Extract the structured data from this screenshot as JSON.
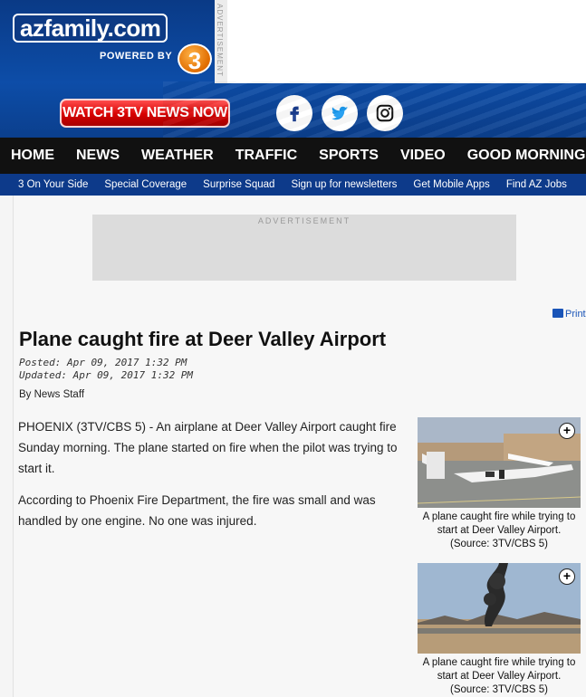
{
  "header": {
    "logo": "azfamily.com",
    "powered_by": "POWERED BY",
    "channel_badge": "3",
    "ad_label_vertical": "ADVERTISEMENT",
    "watch_button": "WATCH 3TV NEWS NOW",
    "social": [
      {
        "name": "facebook",
        "glyph": "f"
      },
      {
        "name": "twitter",
        "glyph": "twitter-bird"
      },
      {
        "name": "instagram",
        "glyph": "instagram-camera"
      }
    ]
  },
  "nav": {
    "items": [
      "HOME",
      "NEWS",
      "WEATHER",
      "TRAFFIC",
      "SPORTS",
      "VIDEO",
      "GOOD MORNING"
    ]
  },
  "subnav": {
    "items": [
      "3 On Your Side",
      "Special Coverage",
      "Surprise Squad",
      "Sign up for newsletters",
      "Get Mobile Apps",
      "Find AZ Jobs"
    ]
  },
  "ad": {
    "label": "ADVERTISEMENT"
  },
  "article": {
    "print_label": "Print",
    "title": "Plane caught fire at Deer Valley Airport",
    "posted": "Posted: Apr 09, 2017 1:32 PM",
    "updated": "Updated: Apr 09, 2017 1:32 PM",
    "byline": "By News Staff",
    "paragraphs": [
      "PHOENIX (3TV/CBS 5) -   An airplane at Deer Valley Airport caught fire Sunday morning. The plane started on fire when the pilot was trying to start it.",
      "According to Phoenix Fire Department, the fire was small and was handled by one engine. No one was injured."
    ],
    "photos": [
      {
        "caption": "A plane caught fire while trying to start at Deer Valley Airport. (Source: 3TV/CBS 5)",
        "expand": "+"
      },
      {
        "caption": "A plane caught fire while trying to start at Deer Valley Airport. (Source: 3TV/CBS 5)",
        "expand": "+"
      }
    ]
  },
  "colors": {
    "header_blue": "#0d4da8",
    "nav_black": "#111111",
    "subnav_blue": "#0d3a8a",
    "watch_red": "#d60000",
    "link_blue": "#1a55b8"
  }
}
